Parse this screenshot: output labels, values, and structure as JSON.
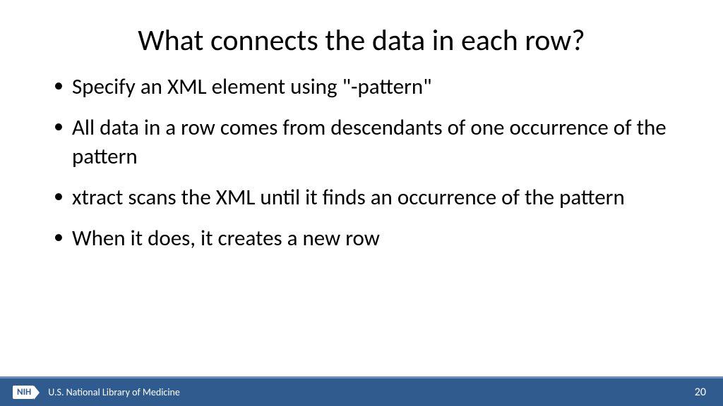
{
  "title": "What connects the data in each row?",
  "bullets": [
    "Specify an XML element using \"-pattern\"",
    "All data in a row comes from descendants of one occurrence of the pattern",
    "xtract scans the XML until it finds an occurrence of the pattern",
    "When it does, it creates a new row"
  ],
  "footer": {
    "logo_text": "NIH",
    "org_name": "U.S. National Library of Medicine",
    "page_number": "20"
  }
}
